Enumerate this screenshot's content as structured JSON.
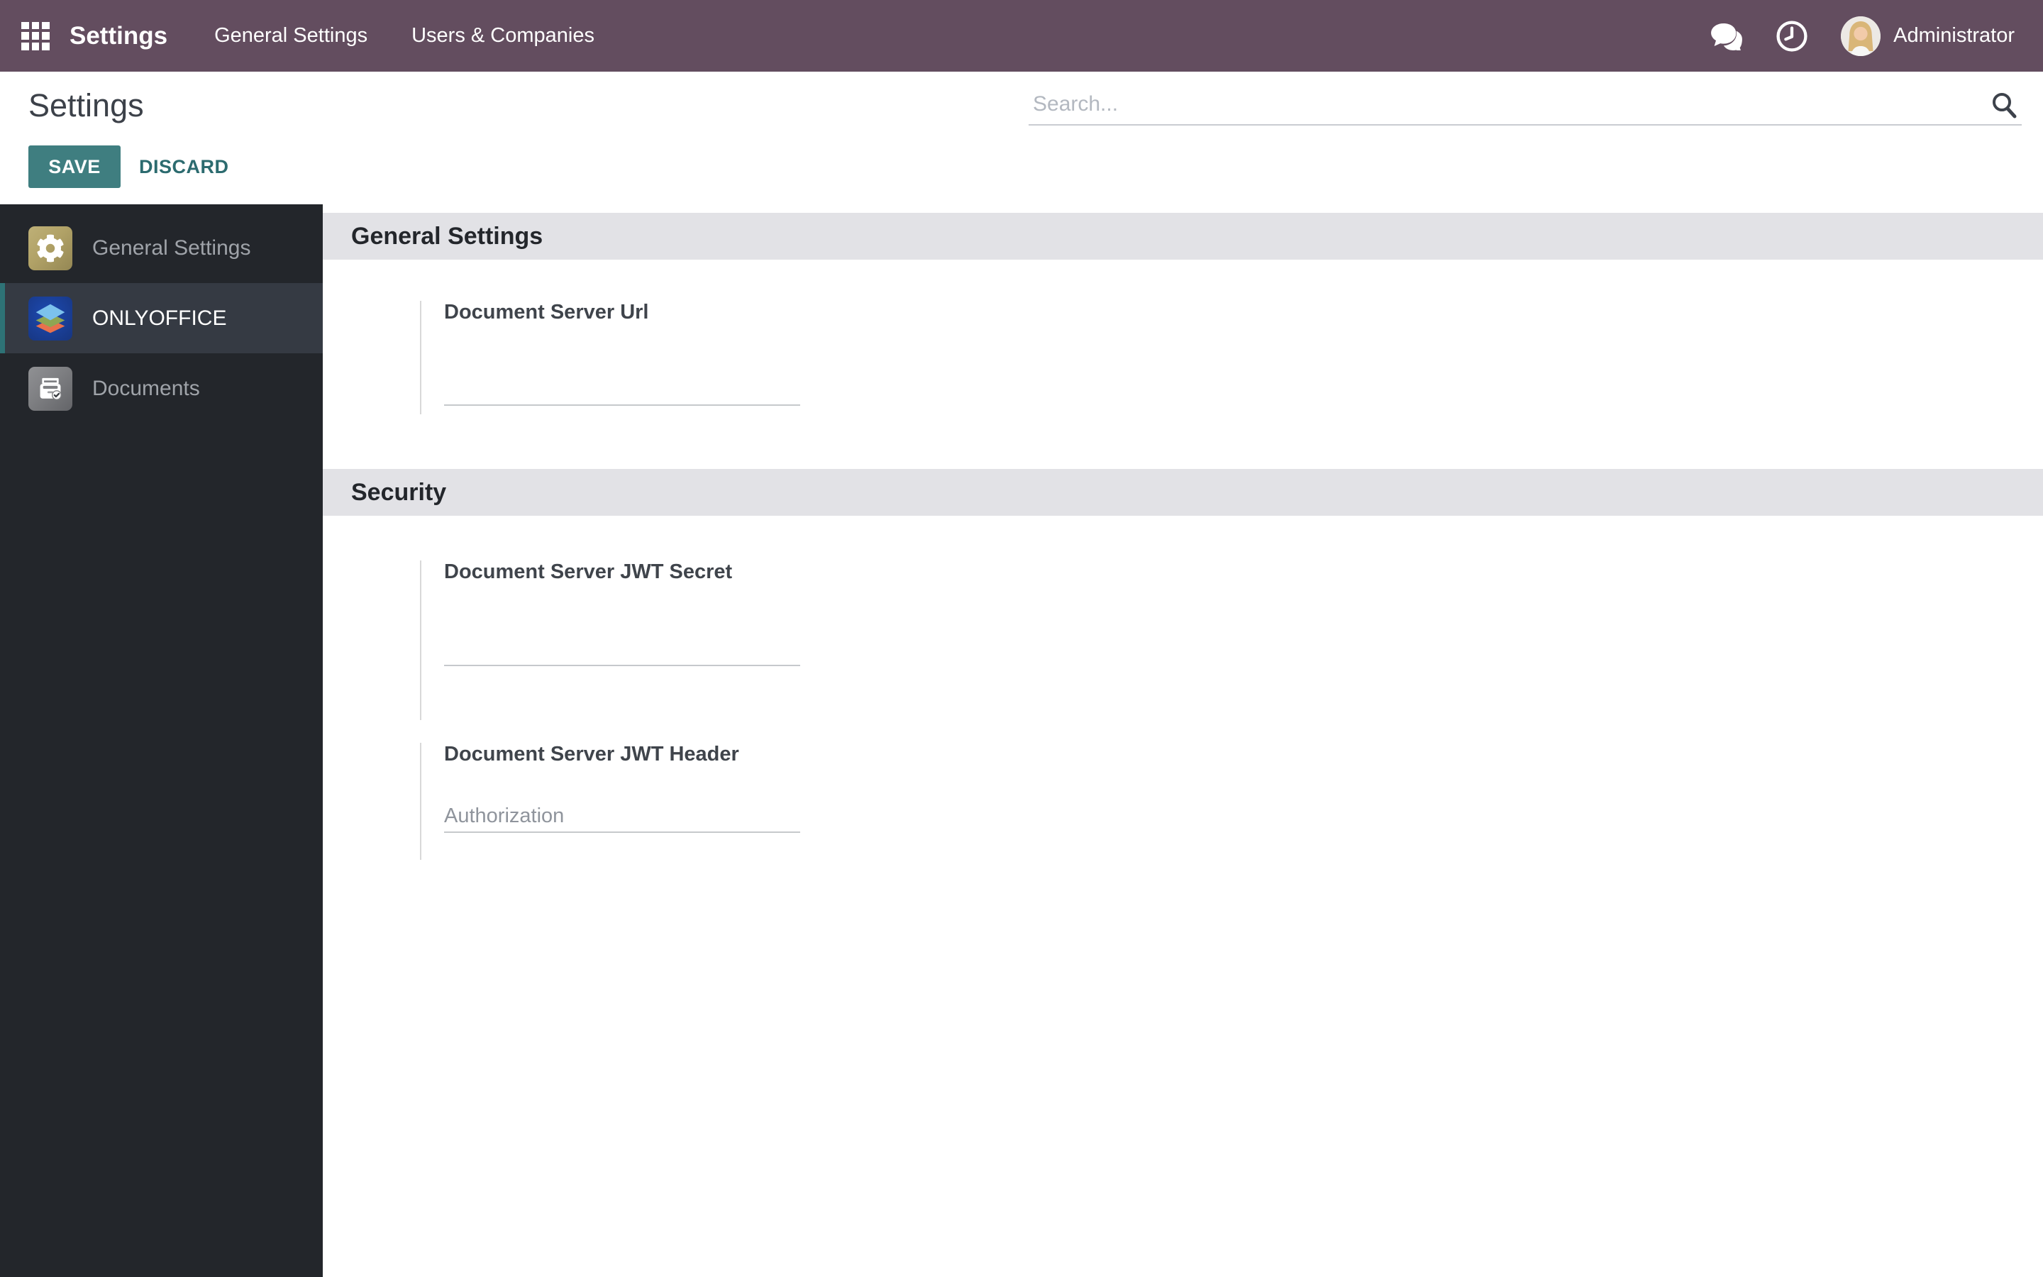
{
  "topbar": {
    "app_title": "Settings",
    "menus": [
      {
        "label": "General Settings"
      },
      {
        "label": "Users & Companies"
      }
    ],
    "icons": [
      "chat-icon",
      "clock-icon"
    ],
    "user": "Administrator"
  },
  "control_panel": {
    "title": "Settings",
    "save_label": "SAVE",
    "discard_label": "DISCARD",
    "search_placeholder": "Search...",
    "search_value": ""
  },
  "sidebar": {
    "items": [
      {
        "label": "General Settings",
        "icon": "gear-icon",
        "selected": false
      },
      {
        "label": "ONLYOFFICE",
        "icon": "onlyoffice-icon",
        "selected": true
      },
      {
        "label": "Documents",
        "icon": "documents-icon",
        "selected": false
      }
    ]
  },
  "main": {
    "sections": [
      {
        "title": "General Settings",
        "fields": [
          {
            "label": "Document Server Url",
            "value": "",
            "placeholder": ""
          }
        ]
      },
      {
        "title": "Security",
        "fields": [
          {
            "label": "Document Server JWT Secret",
            "value": "",
            "placeholder": ""
          },
          {
            "label": "Document Server JWT Header",
            "value": "",
            "placeholder": "Authorization"
          }
        ]
      }
    ]
  },
  "colors": {
    "topbar_bg": "#634d5f",
    "sidebar_bg": "#23262b",
    "sidebar_selected_bg": "#353a43",
    "accent_teal": "#3f7e80",
    "selected_border_teal": "#2e7276",
    "section_band_bg": "#e2e2e6"
  }
}
